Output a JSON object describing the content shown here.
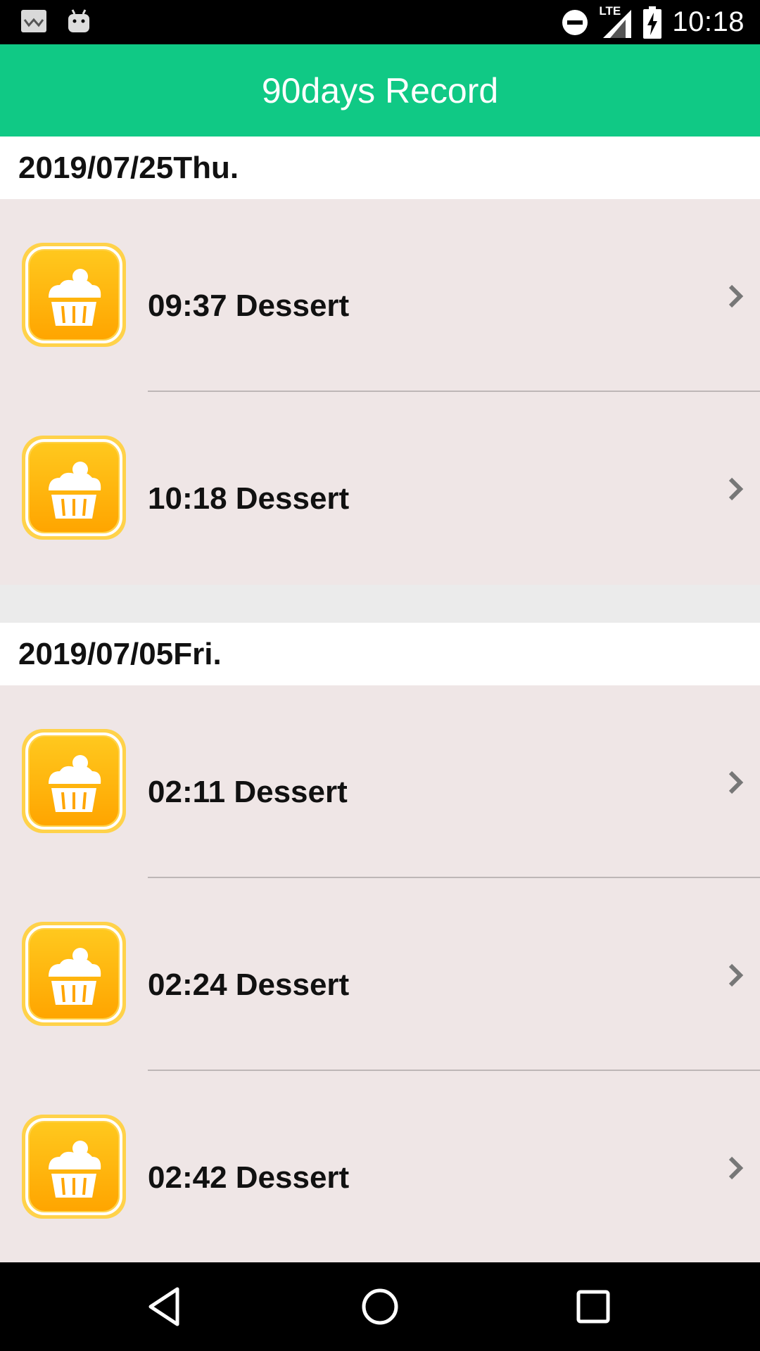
{
  "status_bar": {
    "time": "10:18",
    "network": "LTE",
    "icons_left": [
      "notification-app-icon",
      "android-icon"
    ],
    "icons_right": [
      "dnd-icon",
      "signal-icon",
      "battery-charging-icon"
    ]
  },
  "app_bar": {
    "title": "90days Record",
    "color": "#10c985"
  },
  "sections": [
    {
      "date": "2019/07/25Thu.",
      "entries": [
        {
          "time": "09:37",
          "label": "09:37 Dessert",
          "icon": "cupcake-icon"
        },
        {
          "time": "10:18",
          "label": "10:18 Dessert",
          "icon": "cupcake-icon"
        }
      ]
    },
    {
      "date": "2019/07/05Fri.",
      "entries": [
        {
          "time": "02:11",
          "label": "02:11 Dessert",
          "icon": "cupcake-icon"
        },
        {
          "time": "02:24",
          "label": "02:24 Dessert",
          "icon": "cupcake-icon"
        },
        {
          "time": "02:42",
          "label": "02:42 Dessert",
          "icon": "cupcake-icon"
        }
      ]
    }
  ],
  "nav_bar": {
    "buttons": [
      "back-icon",
      "home-icon",
      "recents-icon"
    ]
  },
  "colors": {
    "accent": "#10c985",
    "entry_bg": "#efe6e6",
    "icon_orange": "#ffb300"
  }
}
